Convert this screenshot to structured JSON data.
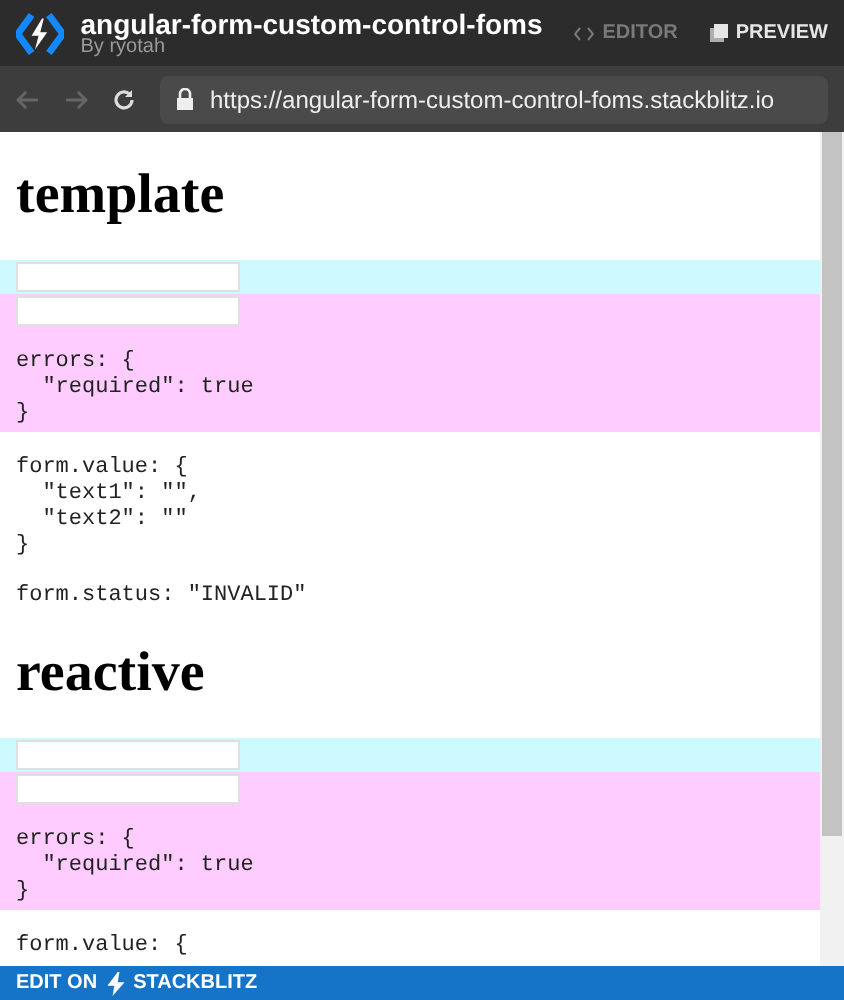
{
  "header": {
    "title": "angular-form-custom-control-foms",
    "author": "By ryotah",
    "tabs": [
      {
        "label": "EDITOR",
        "selected": false
      },
      {
        "label": "PREVIEW",
        "selected": true
      }
    ]
  },
  "address_bar": {
    "url": "https://angular-form-custom-control-foms.stackblitz.io"
  },
  "sections": [
    {
      "title": "template",
      "controls": [
        {
          "valid": true
        },
        {
          "valid": false,
          "errors": "errors: {\n  \"required\": true\n}"
        }
      ],
      "value": "form.value: {\n  \"text1\": \"\",\n  \"text2\": \"\"\n}",
      "status": "form.status: \"INVALID\""
    },
    {
      "title": "reactive",
      "controls": [
        {
          "valid": true
        },
        {
          "valid": false,
          "errors": "errors: {\n  \"required\": true\n}"
        }
      ],
      "value": "form.value: {"
    }
  ],
  "footer": {
    "label": "EDIT ON",
    "brand": "STACKBLITZ"
  }
}
